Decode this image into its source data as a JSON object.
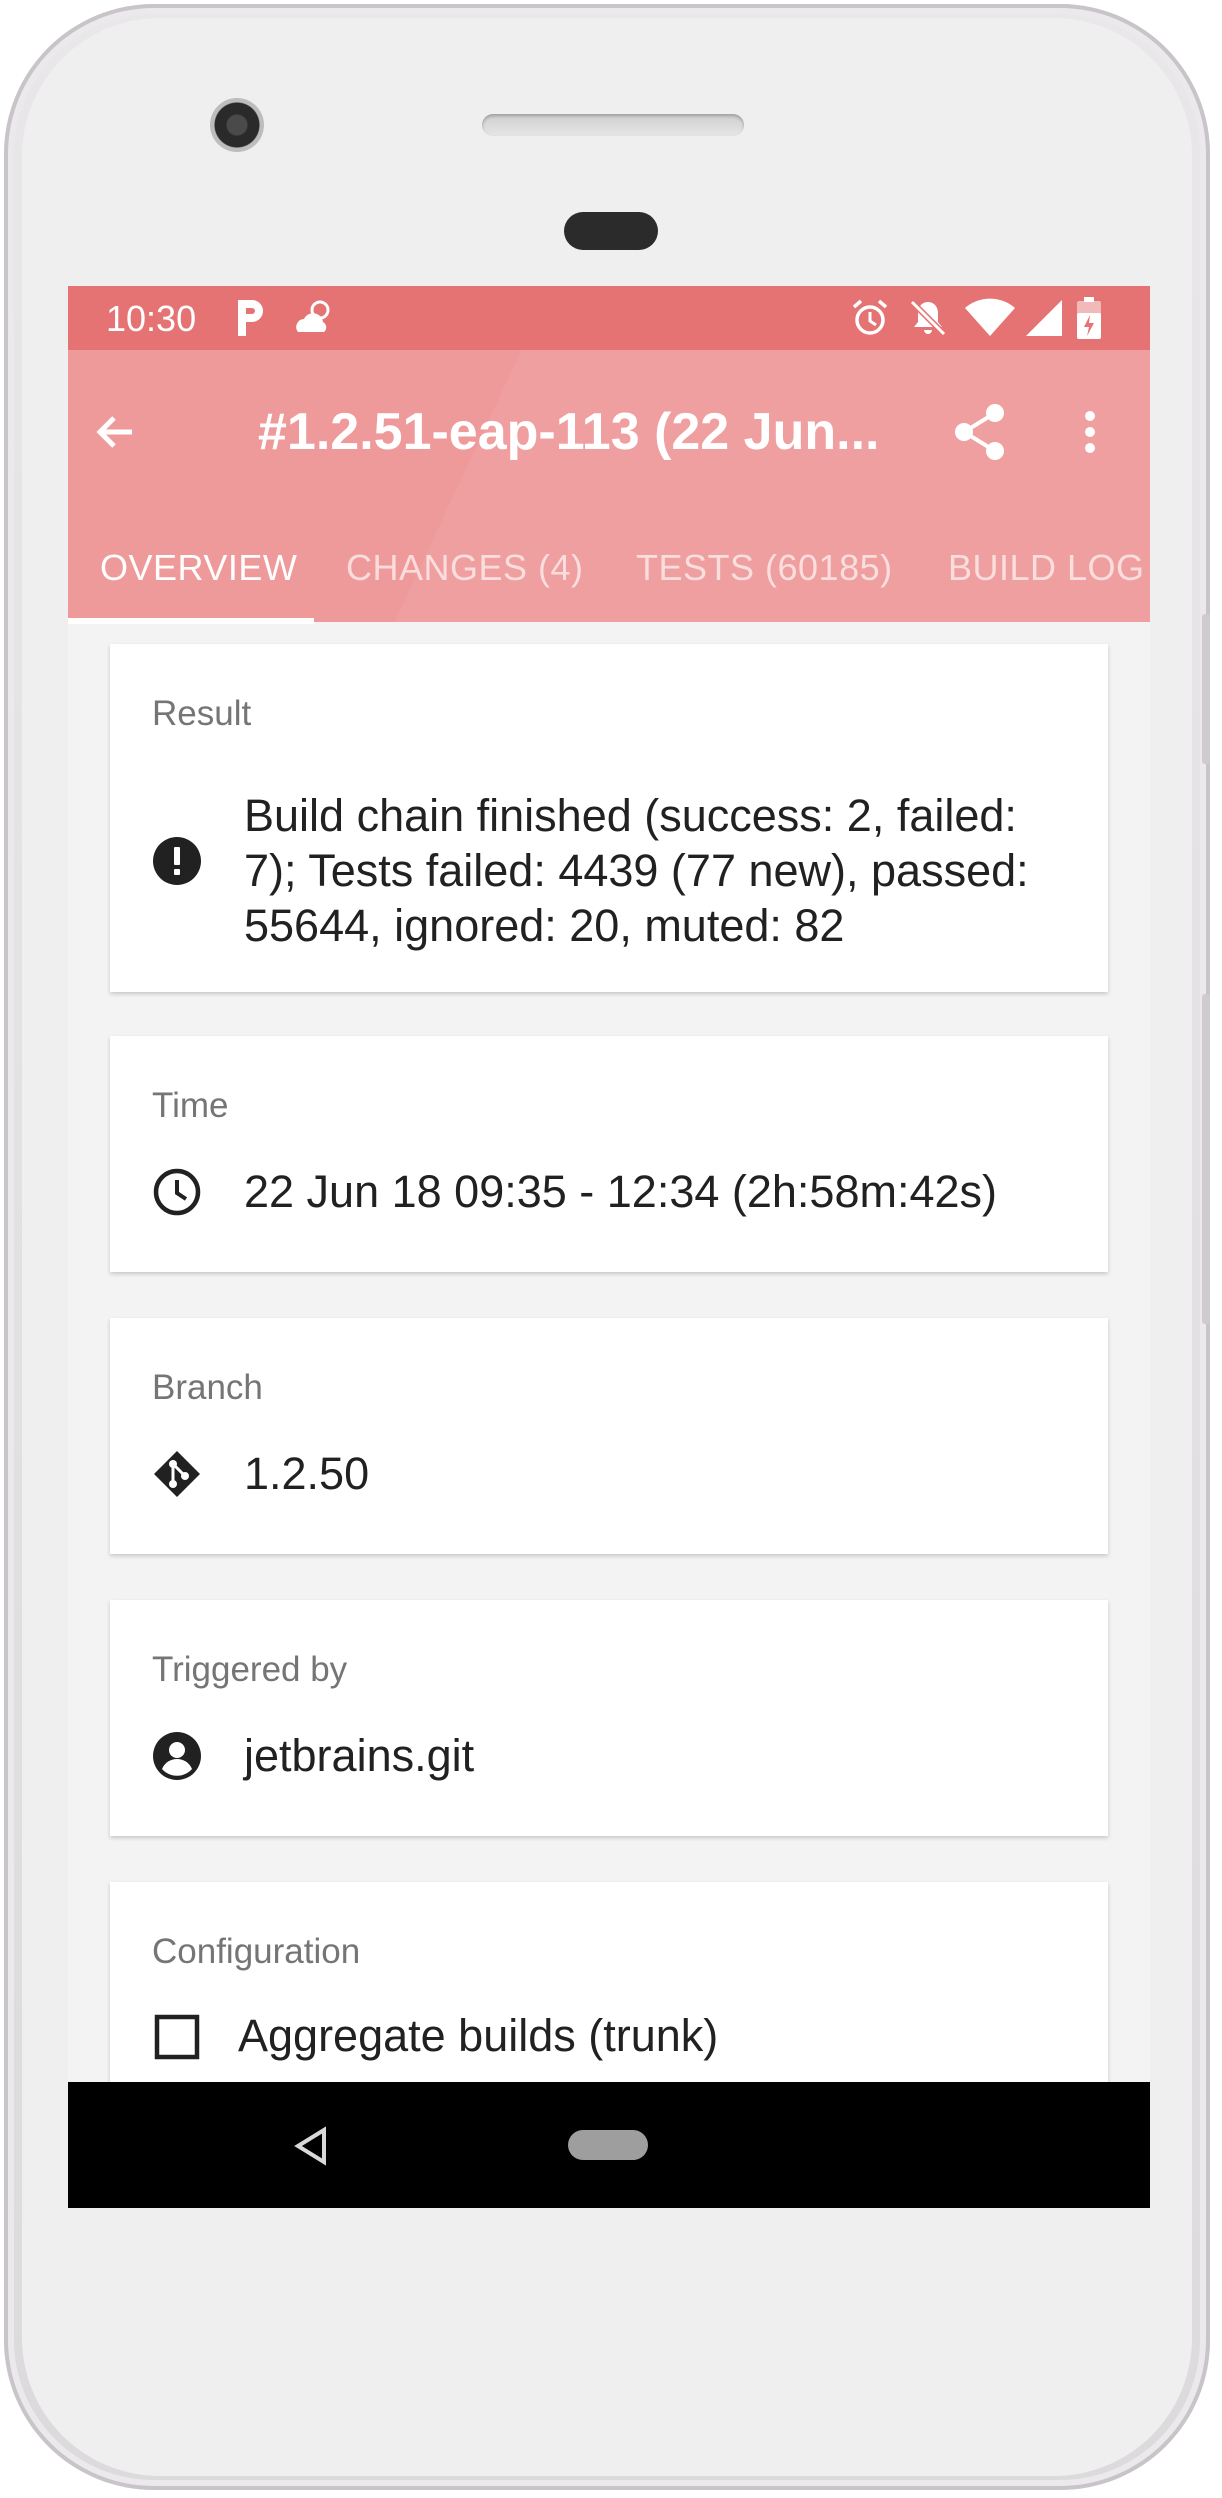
{
  "status_bar": {
    "time": "10:30",
    "left_icons": [
      "parking-icon",
      "weather-icon"
    ],
    "right_icons": [
      "alarm-icon",
      "notifications-off-icon",
      "wifi-icon",
      "signal-icon",
      "battery-icon"
    ]
  },
  "app_bar": {
    "title": "#1.2.51-eap-113 (22 Jun...",
    "back_icon": "arrow-back-icon",
    "share_icon": "share-icon",
    "more_icon": "more-vert-icon",
    "color": "#ef9a9a",
    "status_color": "#e57373"
  },
  "tabs": [
    {
      "label": "OVERVIEW",
      "active": true
    },
    {
      "label": "CHANGES (4)",
      "active": false
    },
    {
      "label": "TESTS (60185)",
      "active": false
    },
    {
      "label": "BUILD LOG",
      "active": false
    }
  ],
  "cards": {
    "result": {
      "label": "Result",
      "icon": "error-icon",
      "line1": "Build chain finished (success: 2, failed:",
      "line2": "7); Tests failed: 4439 (77 new), passed:",
      "line3": "55644, ignored: 20, muted: 82"
    },
    "time": {
      "label": "Time",
      "icon": "clock-icon",
      "value": "22 Jun 18 09:35 - 12:34 (2h:58m:42s)"
    },
    "branch": {
      "label": "Branch",
      "icon": "git-branch-icon",
      "value": "1.2.50"
    },
    "triggered": {
      "label": "Triggered by",
      "icon": "account-circle-icon",
      "value": "jetbrains.git"
    },
    "configuration": {
      "label": "Configuration",
      "icon": "checkbox-outline-icon",
      "value": "Aggregate builds (trunk)"
    }
  },
  "nav_bar": {
    "icons": [
      "back-triangle-icon",
      "home-pill-icon"
    ]
  }
}
